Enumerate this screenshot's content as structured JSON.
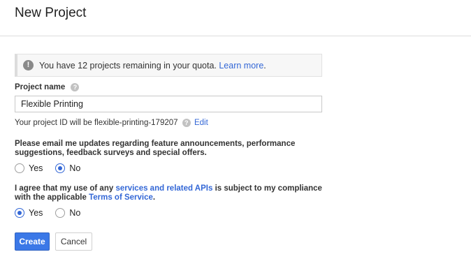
{
  "header": {
    "title": "New Project"
  },
  "notice": {
    "text_prefix": "You have 12 projects remaining in your quota.",
    "link": "Learn more",
    "text_suffix": "."
  },
  "project_name": {
    "label": "Project name",
    "value": "Flexible Printing",
    "help_icon": "help-icon"
  },
  "project_id": {
    "text": "Your project ID will be flexible-printing-179207",
    "edit_label": "Edit"
  },
  "email_updates": {
    "question": "Please email me updates regarding feature announcements, performance suggestions, feedback surveys and special offers.",
    "options": [
      {
        "label": "Yes",
        "selected": false
      },
      {
        "label": "No",
        "selected": true
      }
    ]
  },
  "terms": {
    "text_part1": "I agree that my use of any ",
    "link1": "services and related APIs",
    "text_part2": " is subject to my compliance with the applicable ",
    "link2": "Terms of Service",
    "text_part3": ".",
    "options": [
      {
        "label": "Yes",
        "selected": true
      },
      {
        "label": "No",
        "selected": false
      }
    ]
  },
  "actions": {
    "create_label": "Create",
    "cancel_label": "Cancel"
  },
  "colors": {
    "accent": "#3367d6",
    "primary_button": "#3b78e7"
  }
}
